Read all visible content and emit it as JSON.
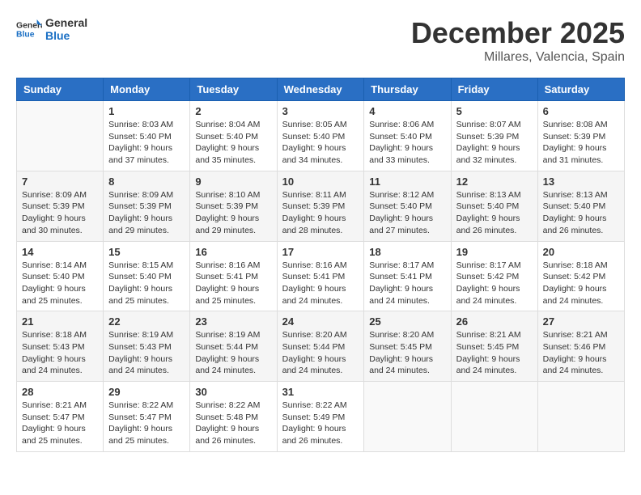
{
  "header": {
    "logo_general": "General",
    "logo_blue": "Blue",
    "month": "December 2025",
    "location": "Millares, Valencia, Spain"
  },
  "weekdays": [
    "Sunday",
    "Monday",
    "Tuesday",
    "Wednesday",
    "Thursday",
    "Friday",
    "Saturday"
  ],
  "weeks": [
    [
      {
        "day": "",
        "sunrise": "",
        "sunset": "",
        "daylight": "",
        "empty": true
      },
      {
        "day": "1",
        "sunrise": "Sunrise: 8:03 AM",
        "sunset": "Sunset: 5:40 PM",
        "daylight": "Daylight: 9 hours and 37 minutes."
      },
      {
        "day": "2",
        "sunrise": "Sunrise: 8:04 AM",
        "sunset": "Sunset: 5:40 PM",
        "daylight": "Daylight: 9 hours and 35 minutes."
      },
      {
        "day": "3",
        "sunrise": "Sunrise: 8:05 AM",
        "sunset": "Sunset: 5:40 PM",
        "daylight": "Daylight: 9 hours and 34 minutes."
      },
      {
        "day": "4",
        "sunrise": "Sunrise: 8:06 AM",
        "sunset": "Sunset: 5:40 PM",
        "daylight": "Daylight: 9 hours and 33 minutes."
      },
      {
        "day": "5",
        "sunrise": "Sunrise: 8:07 AM",
        "sunset": "Sunset: 5:39 PM",
        "daylight": "Daylight: 9 hours and 32 minutes."
      },
      {
        "day": "6",
        "sunrise": "Sunrise: 8:08 AM",
        "sunset": "Sunset: 5:39 PM",
        "daylight": "Daylight: 9 hours and 31 minutes."
      }
    ],
    [
      {
        "day": "7",
        "sunrise": "Sunrise: 8:09 AM",
        "sunset": "Sunset: 5:39 PM",
        "daylight": "Daylight: 9 hours and 30 minutes."
      },
      {
        "day": "8",
        "sunrise": "Sunrise: 8:09 AM",
        "sunset": "Sunset: 5:39 PM",
        "daylight": "Daylight: 9 hours and 29 minutes."
      },
      {
        "day": "9",
        "sunrise": "Sunrise: 8:10 AM",
        "sunset": "Sunset: 5:39 PM",
        "daylight": "Daylight: 9 hours and 29 minutes."
      },
      {
        "day": "10",
        "sunrise": "Sunrise: 8:11 AM",
        "sunset": "Sunset: 5:39 PM",
        "daylight": "Daylight: 9 hours and 28 minutes."
      },
      {
        "day": "11",
        "sunrise": "Sunrise: 8:12 AM",
        "sunset": "Sunset: 5:40 PM",
        "daylight": "Daylight: 9 hours and 27 minutes."
      },
      {
        "day": "12",
        "sunrise": "Sunrise: 8:13 AM",
        "sunset": "Sunset: 5:40 PM",
        "daylight": "Daylight: 9 hours and 26 minutes."
      },
      {
        "day": "13",
        "sunrise": "Sunrise: 8:13 AM",
        "sunset": "Sunset: 5:40 PM",
        "daylight": "Daylight: 9 hours and 26 minutes."
      }
    ],
    [
      {
        "day": "14",
        "sunrise": "Sunrise: 8:14 AM",
        "sunset": "Sunset: 5:40 PM",
        "daylight": "Daylight: 9 hours and 25 minutes."
      },
      {
        "day": "15",
        "sunrise": "Sunrise: 8:15 AM",
        "sunset": "Sunset: 5:40 PM",
        "daylight": "Daylight: 9 hours and 25 minutes."
      },
      {
        "day": "16",
        "sunrise": "Sunrise: 8:16 AM",
        "sunset": "Sunset: 5:41 PM",
        "daylight": "Daylight: 9 hours and 25 minutes."
      },
      {
        "day": "17",
        "sunrise": "Sunrise: 8:16 AM",
        "sunset": "Sunset: 5:41 PM",
        "daylight": "Daylight: 9 hours and 24 minutes."
      },
      {
        "day": "18",
        "sunrise": "Sunrise: 8:17 AM",
        "sunset": "Sunset: 5:41 PM",
        "daylight": "Daylight: 9 hours and 24 minutes."
      },
      {
        "day": "19",
        "sunrise": "Sunrise: 8:17 AM",
        "sunset": "Sunset: 5:42 PM",
        "daylight": "Daylight: 9 hours and 24 minutes."
      },
      {
        "day": "20",
        "sunrise": "Sunrise: 8:18 AM",
        "sunset": "Sunset: 5:42 PM",
        "daylight": "Daylight: 9 hours and 24 minutes."
      }
    ],
    [
      {
        "day": "21",
        "sunrise": "Sunrise: 8:18 AM",
        "sunset": "Sunset: 5:43 PM",
        "daylight": "Daylight: 9 hours and 24 minutes."
      },
      {
        "day": "22",
        "sunrise": "Sunrise: 8:19 AM",
        "sunset": "Sunset: 5:43 PM",
        "daylight": "Daylight: 9 hours and 24 minutes."
      },
      {
        "day": "23",
        "sunrise": "Sunrise: 8:19 AM",
        "sunset": "Sunset: 5:44 PM",
        "daylight": "Daylight: 9 hours and 24 minutes."
      },
      {
        "day": "24",
        "sunrise": "Sunrise: 8:20 AM",
        "sunset": "Sunset: 5:44 PM",
        "daylight": "Daylight: 9 hours and 24 minutes."
      },
      {
        "day": "25",
        "sunrise": "Sunrise: 8:20 AM",
        "sunset": "Sunset: 5:45 PM",
        "daylight": "Daylight: 9 hours and 24 minutes."
      },
      {
        "day": "26",
        "sunrise": "Sunrise: 8:21 AM",
        "sunset": "Sunset: 5:45 PM",
        "daylight": "Daylight: 9 hours and 24 minutes."
      },
      {
        "day": "27",
        "sunrise": "Sunrise: 8:21 AM",
        "sunset": "Sunset: 5:46 PM",
        "daylight": "Daylight: 9 hours and 24 minutes."
      }
    ],
    [
      {
        "day": "28",
        "sunrise": "Sunrise: 8:21 AM",
        "sunset": "Sunset: 5:47 PM",
        "daylight": "Daylight: 9 hours and 25 minutes."
      },
      {
        "day": "29",
        "sunrise": "Sunrise: 8:22 AM",
        "sunset": "Sunset: 5:47 PM",
        "daylight": "Daylight: 9 hours and 25 minutes."
      },
      {
        "day": "30",
        "sunrise": "Sunrise: 8:22 AM",
        "sunset": "Sunset: 5:48 PM",
        "daylight": "Daylight: 9 hours and 26 minutes."
      },
      {
        "day": "31",
        "sunrise": "Sunrise: 8:22 AM",
        "sunset": "Sunset: 5:49 PM",
        "daylight": "Daylight: 9 hours and 26 minutes."
      },
      {
        "day": "",
        "sunrise": "",
        "sunset": "",
        "daylight": "",
        "empty": true
      },
      {
        "day": "",
        "sunrise": "",
        "sunset": "",
        "daylight": "",
        "empty": true
      },
      {
        "day": "",
        "sunrise": "",
        "sunset": "",
        "daylight": "",
        "empty": true
      }
    ]
  ]
}
